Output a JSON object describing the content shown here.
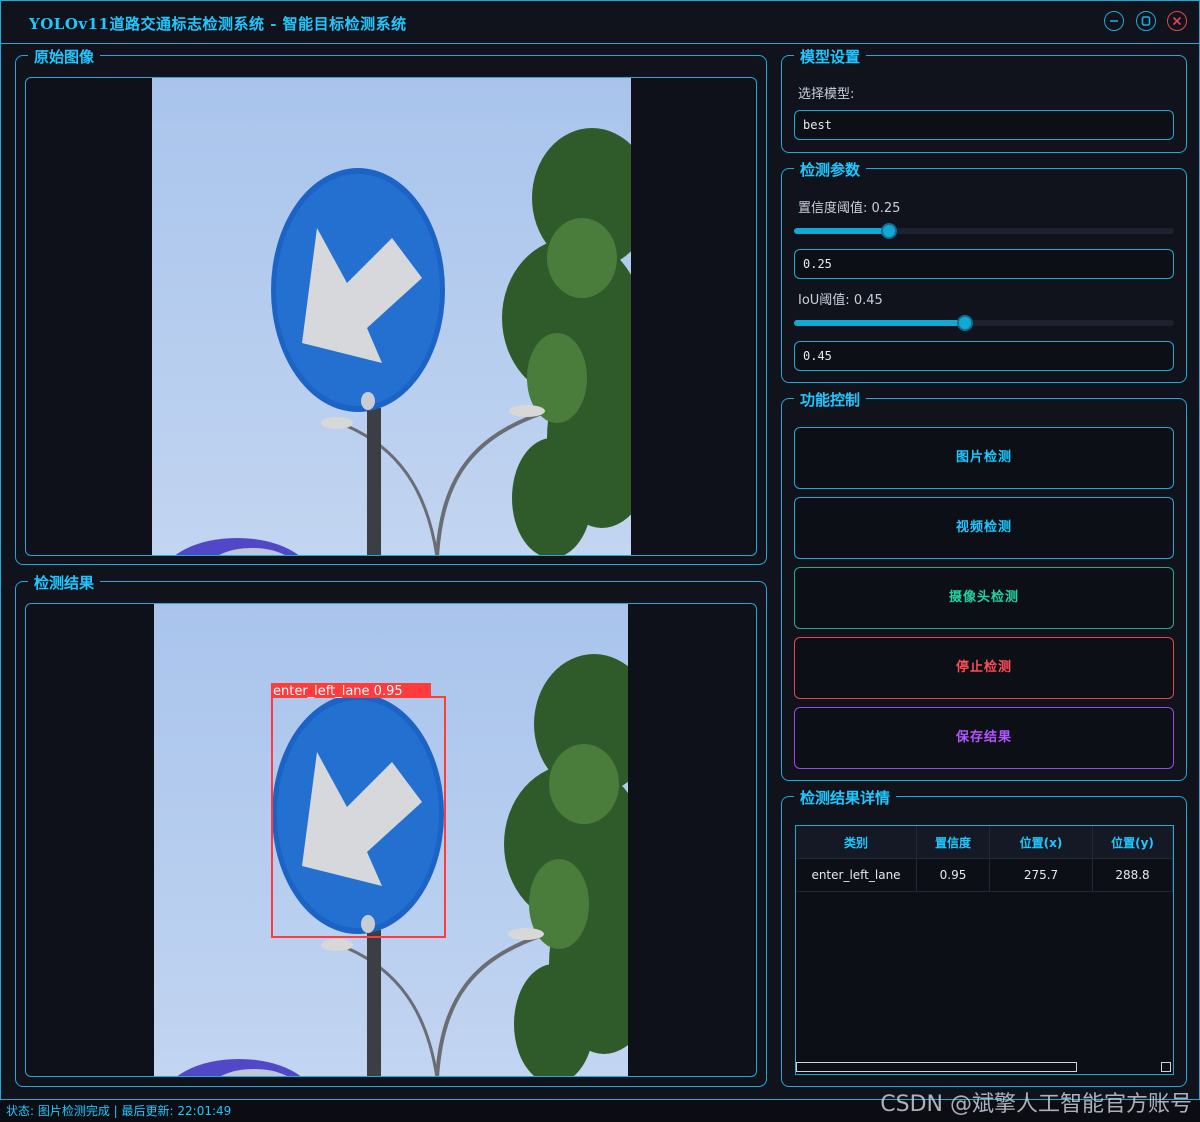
{
  "window": {
    "title": "YOLOv11道路交通标志检测系统 - 智能目标检测系统"
  },
  "panels": {
    "original_label": "原始图像",
    "result_label": "检测结果"
  },
  "detection_box": {
    "label": "enter_left_lane  0.95"
  },
  "model_settings": {
    "group_label": "模型设置",
    "select_label": "选择模型:",
    "select_value": "best"
  },
  "params": {
    "group_label": "检测参数",
    "conf_label": "置信度阈值: 0.25",
    "conf_value": "0.25",
    "conf_fraction": 0.25,
    "iou_label": "IoU阈值: 0.45",
    "iou_value": "0.45",
    "iou_fraction": 0.45
  },
  "functions": {
    "group_label": "功能控制",
    "image_detect": "图片检测",
    "video_detect": "视频检测",
    "camera_detect": "摄像头检测",
    "stop_detect": "停止检测",
    "save_result": "保存结果"
  },
  "colors": {
    "accent": "#1ec8ff",
    "image_btn": "#1ec8ff",
    "video_btn": "#1ec8ff",
    "camera_btn": "#22d3a0",
    "stop_btn": "#ff4d57",
    "save_btn": "#b455ff"
  },
  "results": {
    "group_label": "检测结果详情",
    "headers": [
      "类别",
      "置信度",
      "位置(x)",
      "位置(y)"
    ],
    "rows": [
      [
        "enter_left_lane",
        "0.95",
        "275.7",
        "288.8"
      ]
    ]
  },
  "status": {
    "text": "状态: 图片检测完成 | 最后更新: 22:01:49"
  },
  "watermark": "CSDN @斌擎人工智能官方账号"
}
